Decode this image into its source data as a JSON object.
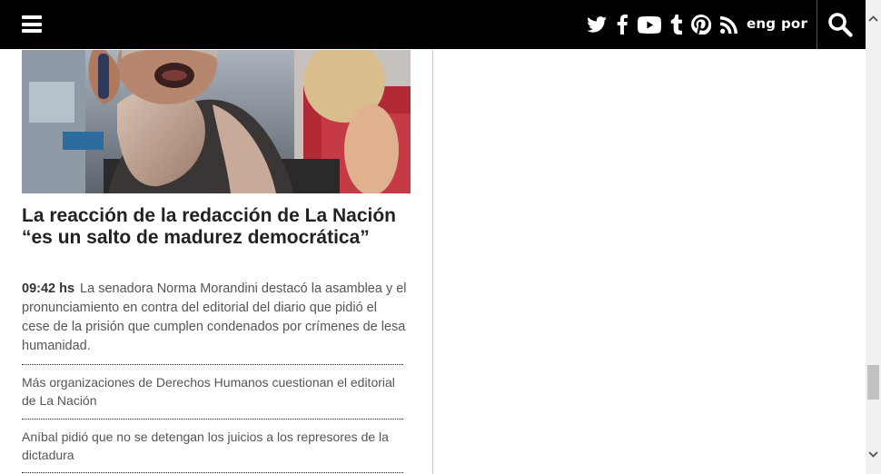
{
  "header": {
    "menu_icon": "hamburger-icon",
    "social_icons": [
      "twitter-icon",
      "facebook-icon",
      "youtube-icon",
      "tumblr-icon",
      "pinterest-icon",
      "rss-icon"
    ],
    "languages": [
      "eng",
      "por"
    ],
    "search_icon": "search-icon",
    "background": "#000000"
  },
  "article": {
    "headline": "La reacción de la redacción de La Nación “es un salto de madurez democrática”",
    "time": "09:42 hs",
    "summary": "La senadora Norma Morandini destacó la asamblea y el pronunciamiento en contra del editorial del diario que pidió el cese de la prisión que cumplen condenados por crímenes de lesa humanidad."
  },
  "related": [
    "Más organizaciones de Derechos Humanos cuestionan el editorial de La Nación",
    "Aníbal pidió que no se detengan los juicios a los represores de la dictadura"
  ]
}
